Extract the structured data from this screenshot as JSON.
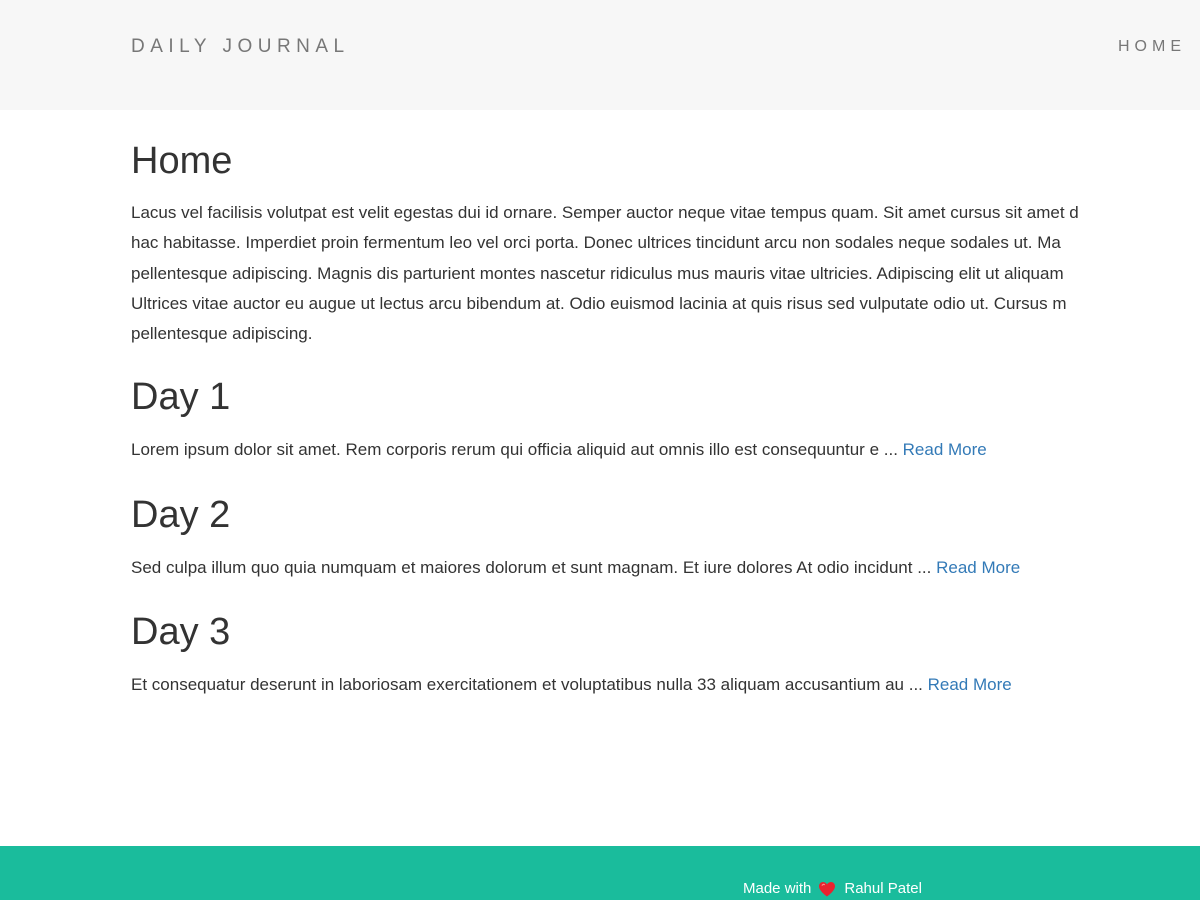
{
  "navbar": {
    "brand": "DAILY JOURNAL",
    "home_link": "HOME"
  },
  "home": {
    "title": "Home",
    "intro_lines": [
      "Lacus vel facilisis volutpat est velit egestas dui id ornare. Semper auctor neque vitae tempus quam. Sit amet cursus sit amet d",
      "hac habitasse. Imperdiet proin fermentum leo vel orci porta. Donec ultrices tincidunt arcu non sodales neque sodales ut. Ma",
      "pellentesque adipiscing. Magnis dis parturient montes nascetur ridiculus mus mauris vitae ultricies. Adipiscing elit ut aliquam",
      "Ultrices vitae auctor eu augue ut lectus arcu bibendum at. Odio euismod lacinia at quis risus sed vulputate odio ut. Cursus m",
      "pellentesque adipiscing."
    ]
  },
  "posts": [
    {
      "title": "Day 1",
      "excerpt": "Lorem ipsum dolor sit amet. Rem corporis rerum qui officia aliquid aut omnis illo est consequuntur e ... ",
      "read_more": "Read More"
    },
    {
      "title": "Day 2",
      "excerpt": "Sed culpa illum quo quia numquam et maiores dolorum et sunt magnam. Et iure dolores At odio incidunt ... ",
      "read_more": "Read More"
    },
    {
      "title": "Day 3",
      "excerpt": "Et consequatur deserunt in laboriosam exercitationem et voluptatibus nulla 33 aliquam accusantium au ... ",
      "read_more": "Read More"
    }
  ],
  "footer": {
    "made_with": "Made with",
    "heart_icon": "heart-icon",
    "author": "Rahul Patel"
  },
  "colors": {
    "navbar_bg": "#f7f7f7",
    "footer_bg": "#1abc9c",
    "link": "#337ab7",
    "heart": "#e8232f"
  }
}
